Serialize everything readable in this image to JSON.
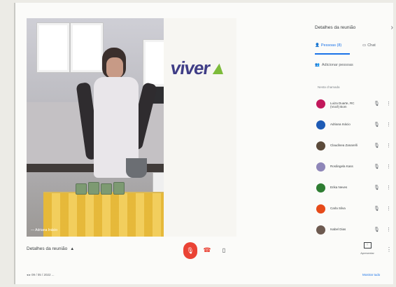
{
  "video": {
    "participant_name": "— Adriana Inácio",
    "banner_logo": "viver",
    "banner_tagline": "",
    "banner_text": ""
  },
  "panel": {
    "title": "Detalhes da reunião",
    "close_icon": "chevron-right-icon",
    "tab_people": "Pessoas (8)",
    "tab_chat": "Chat",
    "add_people": "Adicionar pessoas",
    "section_label": "Nesta chamada",
    "participants": [
      {
        "name": "Luiza Duarte, RC (Você) Bom",
        "color": "#c2185b",
        "mic": "mic-icon"
      },
      {
        "name": "Adriana Inácio",
        "color": "#1e5bb5",
        "mic": "mic-icon"
      },
      {
        "name": "Claudinea Zanarelli",
        "color": "#5b4a3a",
        "mic": "mic-icon"
      },
      {
        "name": "Rosângela Kass",
        "color": "#8e86b8",
        "mic": "mic-icon"
      },
      {
        "name": "Erika Neves",
        "color": "#2e7d32",
        "mic": "mic-icon"
      },
      {
        "name": "Carla Silva",
        "color": "#e64a19",
        "mic": "mic-icon"
      },
      {
        "name": "Isabel Dias",
        "color": "#6d5a50",
        "mic": "mic-icon"
      }
    ]
  },
  "bottom": {
    "meeting_details": "Detalhes da reunião",
    "meta": "◂  ▸ 09 / 05 / 2022  ...",
    "present_label": "Apresentar",
    "more_link": "Mostrar tudo"
  },
  "colors": {
    "accent": "#1a73e8",
    "danger": "#ea4335"
  }
}
